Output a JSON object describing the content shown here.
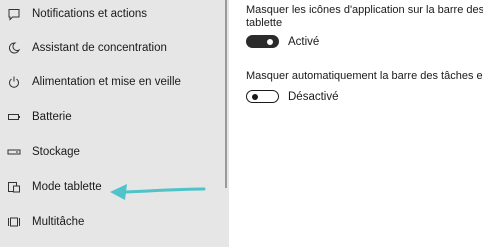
{
  "sidebar": {
    "items": [
      {
        "label": "Notifications et actions",
        "icon": "notifications-icon"
      },
      {
        "label": "Assistant de concentration",
        "icon": "moon-icon"
      },
      {
        "label": "Alimentation et mise en veille",
        "icon": "power-icon"
      },
      {
        "label": "Batterie",
        "icon": "battery-icon"
      },
      {
        "label": "Stockage",
        "icon": "storage-icon"
      },
      {
        "label": "Mode tablette",
        "icon": "tablet-mode-icon"
      },
      {
        "label": "Multitâche",
        "icon": "multitasking-icon"
      }
    ]
  },
  "settings": [
    {
      "description_line1": "Masquer les icônes d'application sur la barre des t",
      "description_line2": "tablette",
      "state_label": "Activé",
      "on": true
    },
    {
      "description_line1": "Masquer automatiquement la barre des tâches en",
      "state_label": "Désactivé",
      "on": false
    }
  ],
  "colors": {
    "sidebar_bg": "#e6e6e6",
    "arrow": "#4fc3c8",
    "toggle_on": "#2b2b2b"
  }
}
